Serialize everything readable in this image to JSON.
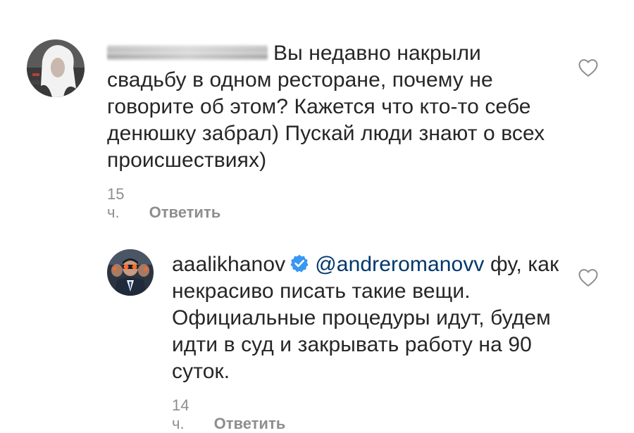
{
  "comments": [
    {
      "text": "Вы недавно накрыли свадьбу в одном ресторане, почему не говорите об этом? Кажется что кто-то себе денюшку забрал) Пускай люди знают о всех происшествиях)",
      "time": "15 ч.",
      "reply_label": "Ответить",
      "like_icon": "heart-outline-icon"
    },
    {
      "username": "aaalikhanov",
      "verified_icon": "verified-badge-icon",
      "mention": "@andreromanovv",
      "text": "фу, как некрасиво писать такие вещи. Официальные процедуры идут, будем идти в суд и закрывать работу на 90 суток.",
      "time": "14 ч.",
      "reply_label": "Ответить",
      "like_icon": "heart-outline-icon"
    }
  ],
  "colors": {
    "text": "#262626",
    "secondary": "#8e8e8e",
    "mention": "#00376b",
    "verified": "#3897f0"
  }
}
